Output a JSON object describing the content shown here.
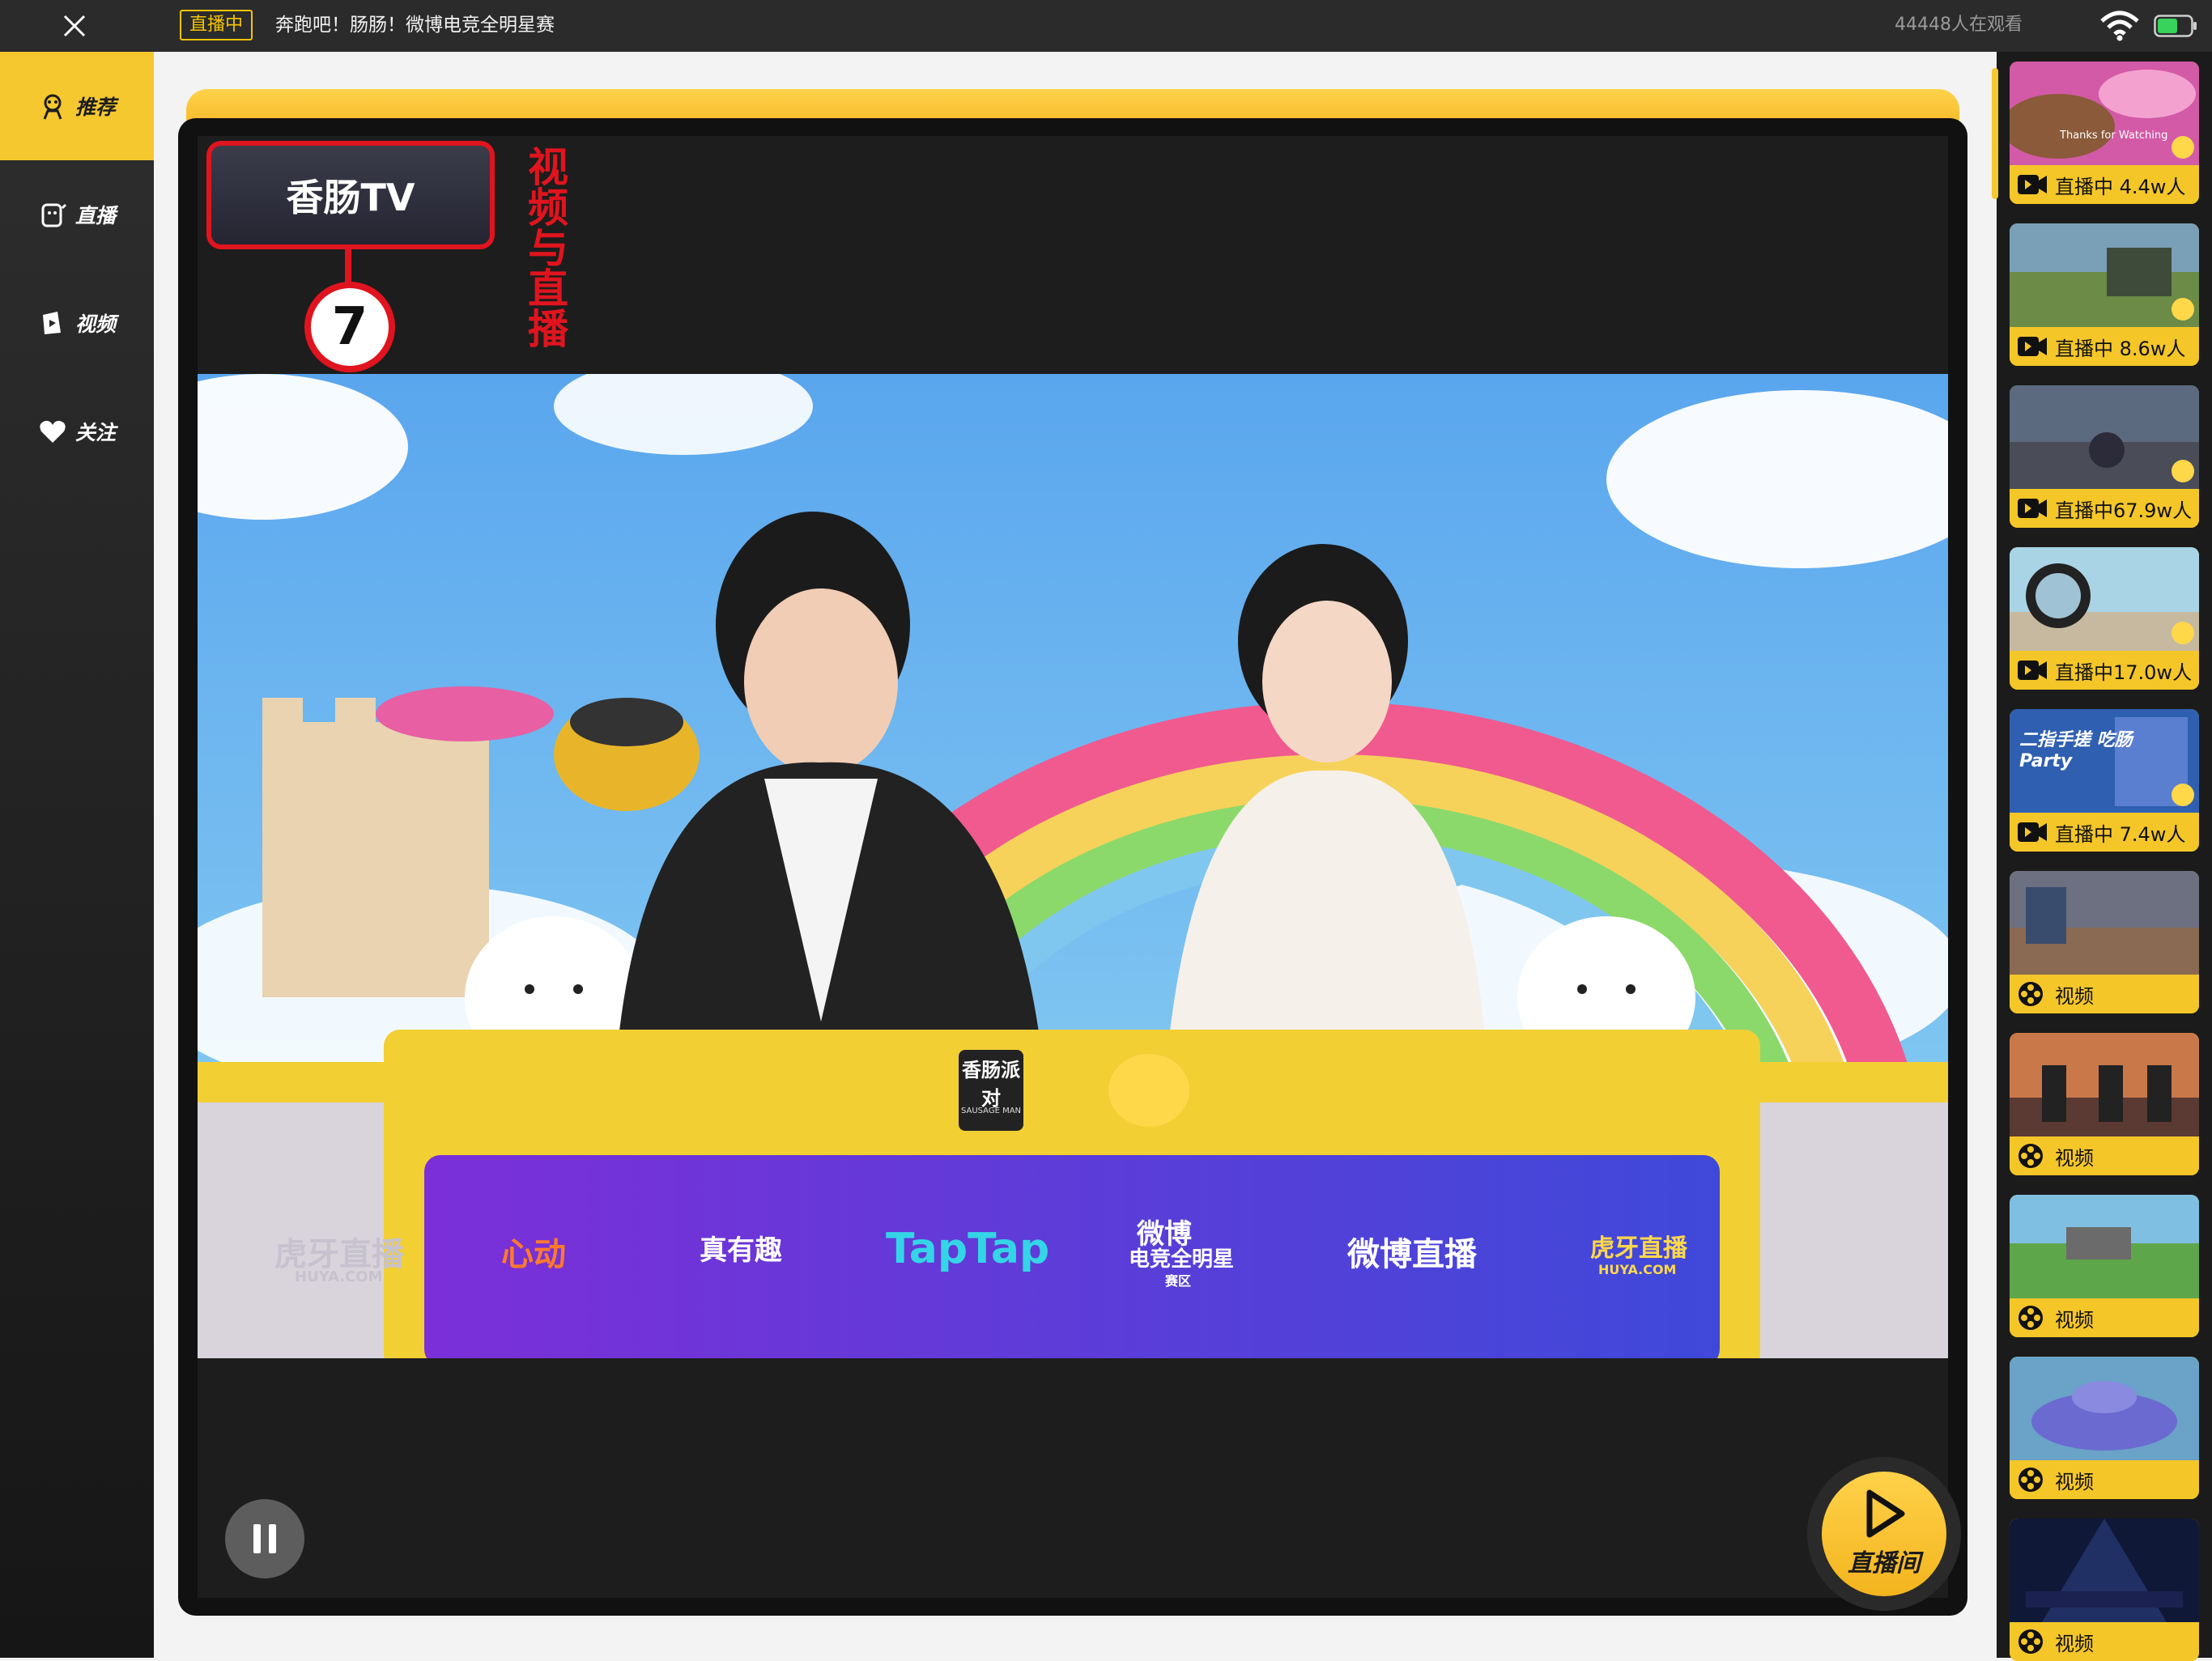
{
  "topbar": {
    "live_tag": "直播中",
    "title": "奔跑吧！肠肠！微博电竞全明星赛",
    "viewers": "44448人在观看"
  },
  "sidebar": {
    "items": [
      {
        "label": "推荐",
        "icon": "recommend-icon",
        "active": true
      },
      {
        "label": "直播",
        "icon": "live-icon",
        "active": false
      },
      {
        "label": "视频",
        "icon": "video-icon",
        "active": false
      },
      {
        "label": "关注",
        "icon": "heart-icon",
        "active": false
      }
    ]
  },
  "player": {
    "badge_logo": "香肠TV",
    "badge_number": "7",
    "annotation": "视频与直播",
    "sponsors": [
      "虎牙直播",
      "HUYA.COM",
      "心动",
      "真有趣",
      "TapTap",
      "微博",
      "电竞全明星",
      "赛区",
      "微博直播",
      "虎牙直播",
      "HUYA.COM"
    ],
    "desk_logos": [
      "香肠派对",
      "SAUSAGE MAN"
    ],
    "live_room_label": "直播间"
  },
  "list": {
    "items": [
      {
        "type": "live",
        "label": "直播中 4.4w人",
        "thumb_text": "Thanks for Watching"
      },
      {
        "type": "live",
        "label": "直播中 8.6w人"
      },
      {
        "type": "live",
        "label": "直播中67.9w人"
      },
      {
        "type": "live",
        "label": "直播中17.0w人"
      },
      {
        "type": "live",
        "label": "直播中 7.4w人",
        "thumb_text": "二指手搓 吃肠Party"
      },
      {
        "type": "video",
        "label": "视频"
      },
      {
        "type": "video",
        "label": "视频"
      },
      {
        "type": "video",
        "label": "视频"
      },
      {
        "type": "video",
        "label": "视频"
      },
      {
        "type": "video",
        "label": "视频"
      }
    ]
  },
  "colors": {
    "accent_yellow": "#f5c830",
    "annotation_red": "#e0141e",
    "dark_bg": "#1d1d1d"
  }
}
